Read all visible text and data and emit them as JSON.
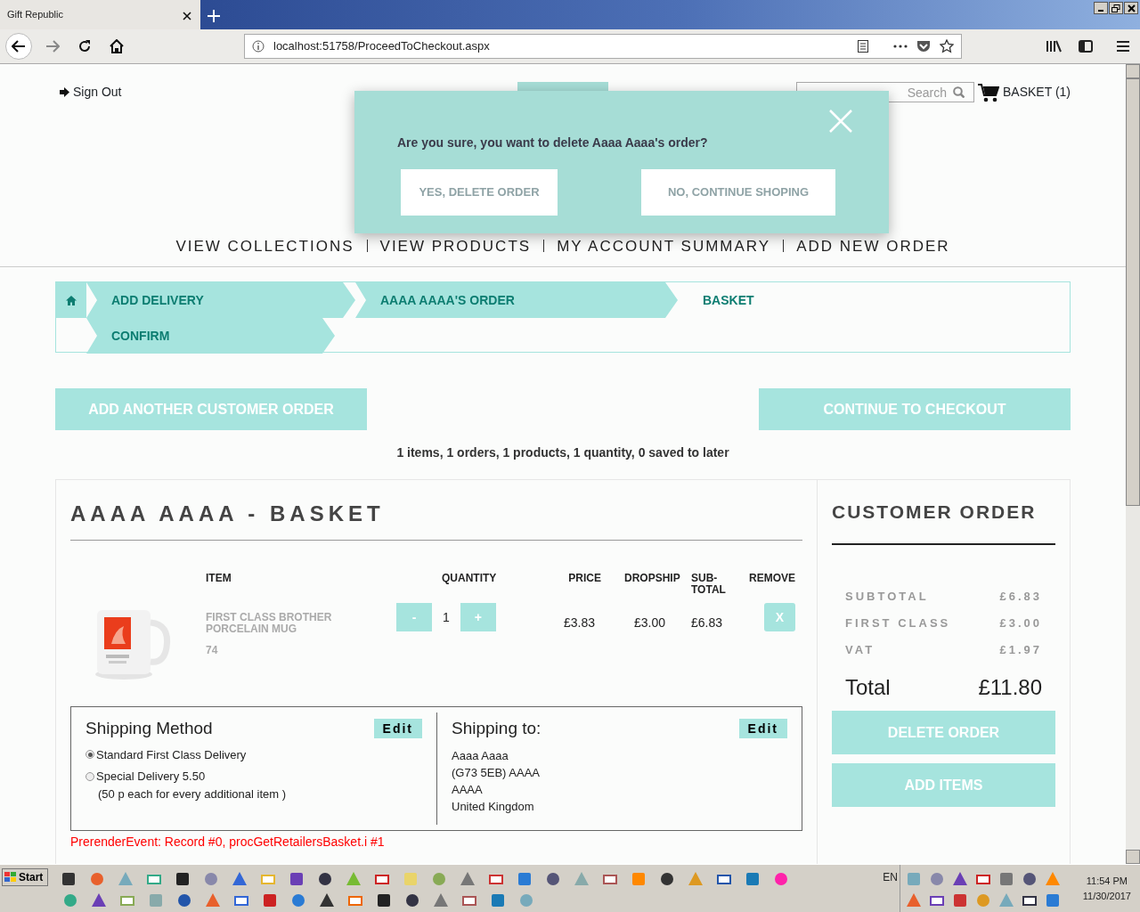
{
  "browser": {
    "tab_title": "Gift Republic",
    "url": "localhost:51758/ProceedToCheckout.aspx"
  },
  "header": {
    "sign_out": "Sign Out",
    "search": {
      "placeholder": "Search"
    },
    "basket": "BASKET (1)"
  },
  "nav": [
    "VIEW COLLECTIONS",
    "VIEW PRODUCTS",
    "MY ACCOUNT SUMMARY",
    "ADD NEW ORDER"
  ],
  "modal": {
    "message": "Are you sure, you want to delete Aaaa Aaaa's order?",
    "buttons": [
      "YES, DELETE ORDER",
      "NO, CONTINUE SHOPING"
    ]
  },
  "breadcrumb": [
    {
      "label": "ADD DELIVERY",
      "highlighted": true
    },
    {
      "label": "AAAA AAAA'S ORDER",
      "highlighted": true
    },
    {
      "label": "BASKET",
      "highlighted": false
    },
    {
      "label": "CONFIRM",
      "highlighted": true
    }
  ],
  "actions": [
    "ADD ANOTHER CUSTOMER ORDER",
    "CONTINUE TO CHECKOUT"
  ],
  "summary_line": "1 items, 1 orders, 1 products, 1 quantity, 0 saved to later",
  "basket": {
    "title": "AAAA AAAA - BASKET",
    "columns": [
      "ITEM",
      "QUANTITY",
      "PRICE",
      "DROPSHIP",
      "SUB-TOTAL",
      "REMOVE"
    ],
    "items": [
      {
        "name": "FIRST CLASS BROTHER PORCELAIN MUG",
        "code": "74",
        "decrement": "-",
        "quantity": "1",
        "increment": "+",
        "price": "£3.83",
        "dropship": "£3.00",
        "subtotal": "£6.83",
        "remove": "X"
      }
    ],
    "shipping_method": {
      "title": "Shipping Method",
      "edit": "Edit",
      "options": [
        {
          "label": "Standard First Class Delivery",
          "selected": true
        },
        {
          "label": "Special Delivery 5.50",
          "note": "(50 p each for every additional item )",
          "selected": false
        }
      ]
    },
    "shipping_to": {
      "title": "Shipping to:",
      "edit": "Edit",
      "lines": [
        "Aaaa Aaaa",
        "(G73 5EB) AAAA",
        "AAAA",
        "United Kingdom"
      ]
    },
    "debug": "PrerenderEvent: Record #0, procGetRetailersBasket.i #1"
  },
  "order": {
    "title": "CUSTOMER ORDER",
    "lines": [
      {
        "label": "SUBTOTAL",
        "value": "£6.83"
      },
      {
        "label": "FIRST CLASS",
        "value": "£3.00"
      },
      {
        "label": "VAT",
        "value": "£1.97"
      }
    ],
    "total_label": "Total",
    "total": "£11.80",
    "buttons": [
      "DELETE ORDER",
      "ADD ITEMS"
    ]
  },
  "taskbar": {
    "start": "Start",
    "language": "EN",
    "time": "11:54 PM",
    "date": "11/30/2017"
  }
}
